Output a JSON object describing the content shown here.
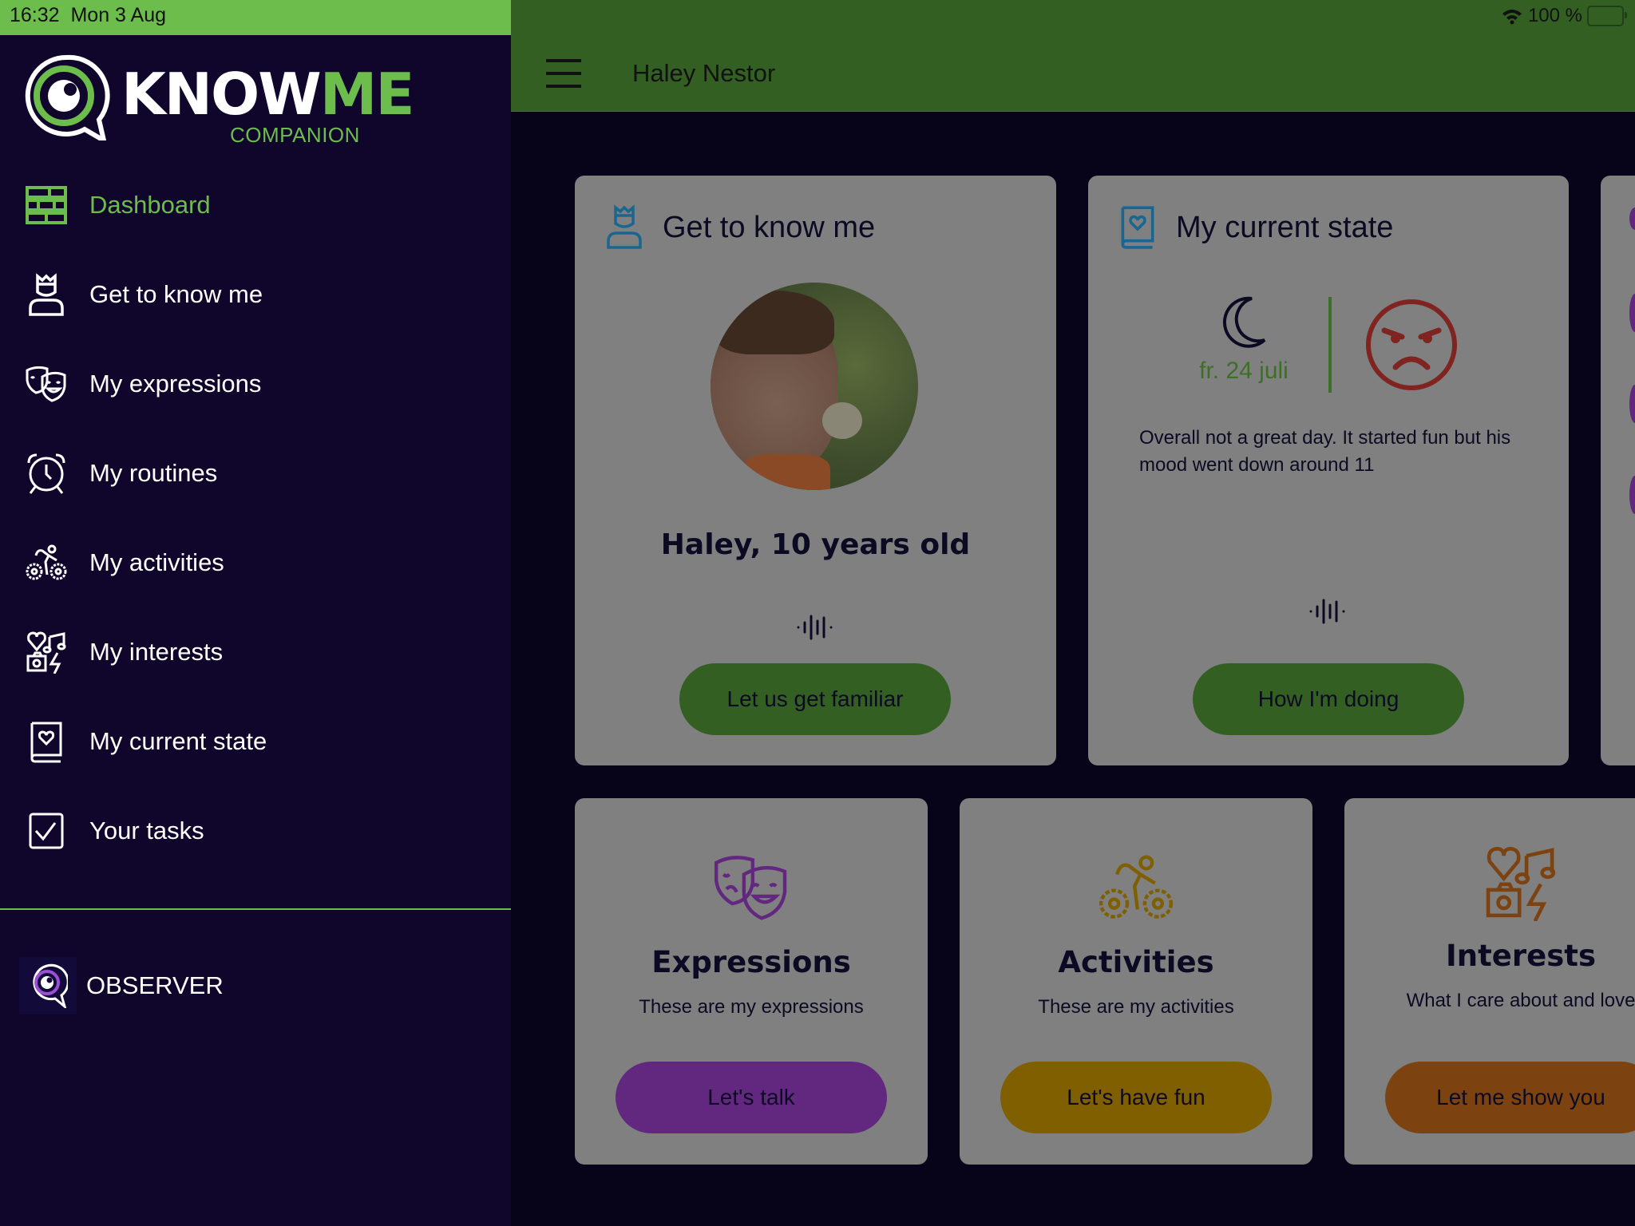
{
  "status_bar": {
    "time": "16:32",
    "date": "Mon 3 Aug",
    "battery": "100 %",
    "battery_level_percent": 100
  },
  "logo": {
    "text_a": "KNOW",
    "text_b": "ME",
    "subtitle": "COMPANION"
  },
  "header": {
    "title": "Haley Nestor"
  },
  "sidebar": {
    "items": [
      {
        "label": "Dashboard",
        "icon": "dashboard-icon",
        "active": true
      },
      {
        "label": "Get to know me",
        "icon": "person-icon"
      },
      {
        "label": "My expressions",
        "icon": "theater-masks-icon"
      },
      {
        "label": "My routines",
        "icon": "alarm-clock-icon"
      },
      {
        "label": "My activities",
        "icon": "bicycle-icon"
      },
      {
        "label": "My interests",
        "icon": "interests-icon"
      },
      {
        "label": "My current state",
        "icon": "heart-book-icon"
      },
      {
        "label": "Your tasks",
        "icon": "checkbox-icon"
      }
    ],
    "observer_label": "OBSERVER"
  },
  "cards": {
    "know_me": {
      "title": "Get to know me",
      "name_age": "Haley, 10 years old",
      "button": "Let us get familiar"
    },
    "current_state": {
      "title": "My current state",
      "date": "fr. 24 juli",
      "mood": "angry",
      "note": "Overall not a great day. It started fun but his mood went down around 11",
      "button": "How I'm doing"
    },
    "expressions": {
      "title": "Expressions",
      "subtitle": "These are my expressions",
      "button": "Let's talk"
    },
    "activities": {
      "title": "Activities",
      "subtitle": "These are my activities",
      "button": "Let's have fun"
    },
    "interests": {
      "title": "Interests",
      "subtitle": "What I care about and love",
      "button": "Let me show you"
    }
  },
  "colors": {
    "brand_green": "#6cbd4b",
    "sidebar_bg": "#10062c",
    "purple": "#62287f",
    "gold": "#7f5f00",
    "orange": "#7c4310",
    "angry_red": "#7f2420",
    "blue_icon": "#1a6690"
  }
}
